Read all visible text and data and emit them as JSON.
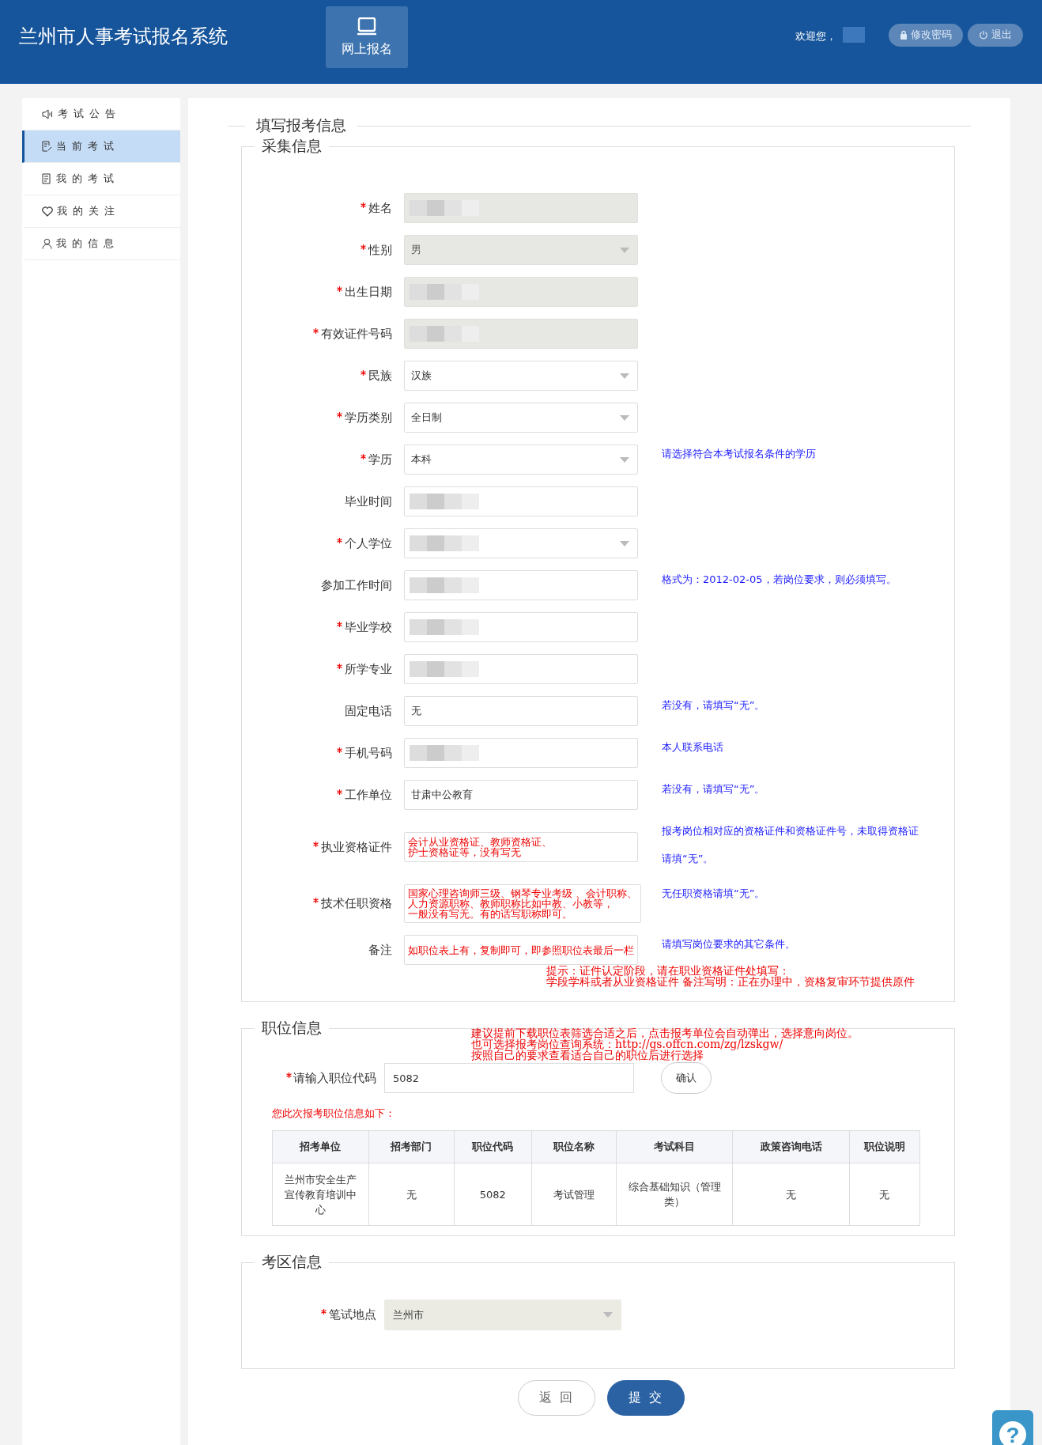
{
  "header": {
    "title": "兰州市人事考试报名系统",
    "nav": [
      {
        "label": "网上报名",
        "selected": true
      }
    ],
    "welcome": "欢迎您，",
    "user_redacted": true,
    "buttons": [
      {
        "kind": "lock",
        "label": "修改密码"
      },
      {
        "kind": "power",
        "label": "退出"
      }
    ]
  },
  "sidebar": {
    "items": [
      {
        "label": "考试公告",
        "selected": false
      },
      {
        "label": "当前考试",
        "selected": true
      },
      {
        "label": "我的考试",
        "selected": false
      },
      {
        "label": "我的关注",
        "selected": false
      },
      {
        "label": "我的信息",
        "selected": false
      }
    ]
  },
  "form": {
    "title": "填写报考信息",
    "section": "采集信息",
    "fields": [
      {
        "label": "姓名",
        "required": true,
        "kind": "input",
        "disabled": true,
        "redacted": true
      },
      {
        "label": "性别",
        "required": true,
        "kind": "select",
        "disabled": true,
        "value": "男"
      },
      {
        "label": "出生日期",
        "required": true,
        "kind": "input",
        "disabled": true,
        "redacted": true
      },
      {
        "label": "有效证件号码",
        "required": true,
        "kind": "input",
        "disabled": true,
        "redacted": true
      },
      {
        "label": "民族",
        "required": true,
        "kind": "select",
        "disabled": false,
        "value": "汉族"
      },
      {
        "label": "学历类别",
        "required": true,
        "kind": "select",
        "disabled": false,
        "value": "全日制"
      },
      {
        "label": "学历",
        "required": true,
        "kind": "select",
        "disabled": false,
        "value": "本科",
        "hint": "请选择符合本考试报名条件的学历"
      },
      {
        "label": "毕业时间",
        "required": false,
        "kind": "input",
        "disabled": false,
        "redacted": true
      },
      {
        "label": "个人学位",
        "required": true,
        "kind": "select",
        "disabled": false,
        "redacted": true
      },
      {
        "label": "参加工作时间",
        "required": false,
        "kind": "input",
        "disabled": false,
        "redacted": true,
        "hint": "格式为：2012-02-05，若岗位要求，则必须填写。"
      },
      {
        "label": "毕业学校",
        "required": true,
        "kind": "input",
        "disabled": false,
        "redacted": true
      },
      {
        "label": "所学专业",
        "required": true,
        "kind": "input",
        "disabled": false,
        "redacted": true
      },
      {
        "label": "固定电话",
        "required": false,
        "kind": "input",
        "disabled": false,
        "value": "无",
        "hint": "若没有，请填写“无”。"
      },
      {
        "label": "手机号码",
        "required": true,
        "kind": "input",
        "disabled": false,
        "redacted": true,
        "hint": "本人联系电话"
      },
      {
        "label": "工作单位",
        "required": true,
        "kind": "input",
        "disabled": false,
        "value": "甘肃中公教育",
        "hint": "若没有，请填写“无”。"
      },
      {
        "label": "执业资格证件",
        "required": true,
        "kind": "input",
        "disabled": false,
        "hint": "报考岗位相对应的资格证件和资格证件号，未取得资格证请填“无”。",
        "annotation": [
          "会计从业资格证、教师资格证、",
          "护士资格证等，没有写无"
        ]
      },
      {
        "label": "技术任职资格",
        "required": true,
        "kind": "input",
        "disabled": false,
        "hint": "无任职资格请填“无”。",
        "annotation": [
          "国家心理咨询师三级、钢琴专业考级 、会计职称、",
          "人力资源职称、教师职称比如中教、小教等，",
          "一般没有写无。有的话写职称即可。"
        ]
      },
      {
        "label": "备注",
        "required": false,
        "kind": "input",
        "disabled": false,
        "hint": "请填写岗位要求的其它条件。",
        "annotation": [
          "如职位表上有，复制即可，即参照职位表最后一栏"
        ]
      }
    ],
    "tip": [
      "提示：证件认定阶段，请在职业资格证件处填写：",
      "学段学科或者从业资格证件 备注写明：正在办理中，资格复审环节提供原件"
    ]
  },
  "job": {
    "section": "职位信息",
    "note": [
      "建议提前下载职位表筛选合适之后，点击报考单位会自动弹出，选择意向岗位。",
      "也可选择报考岗位查询系统：http://gs.offcn.com/zg/lzskgw/",
      "按照自己的要求查看适合自己的职位后进行选择"
    ],
    "code_label": "请输入职位代码",
    "code_required": true,
    "code_value": "5082",
    "confirm": "确认",
    "result_label": "您此次报考职位信息如下：",
    "table": {
      "columns": [
        "招考单位",
        "招考部门",
        "职位代码",
        "职位名称",
        "考试科目",
        "政策咨询电话",
        "职位说明"
      ],
      "rows": [
        [
          "兰州市安全生产宣传教育培训中心",
          "无",
          "5082",
          "考试管理",
          "综合基础知识（管理类）",
          "无",
          "无"
        ]
      ]
    }
  },
  "area": {
    "section": "考区信息",
    "label": "笔试地点",
    "required": true,
    "value": "兰州市",
    "disabled": true
  },
  "actions": [
    {
      "kind": "secondary",
      "label": "返 回"
    },
    {
      "kind": "primary",
      "label": "提 交"
    }
  ],
  "help": {
    "label": "?"
  }
}
